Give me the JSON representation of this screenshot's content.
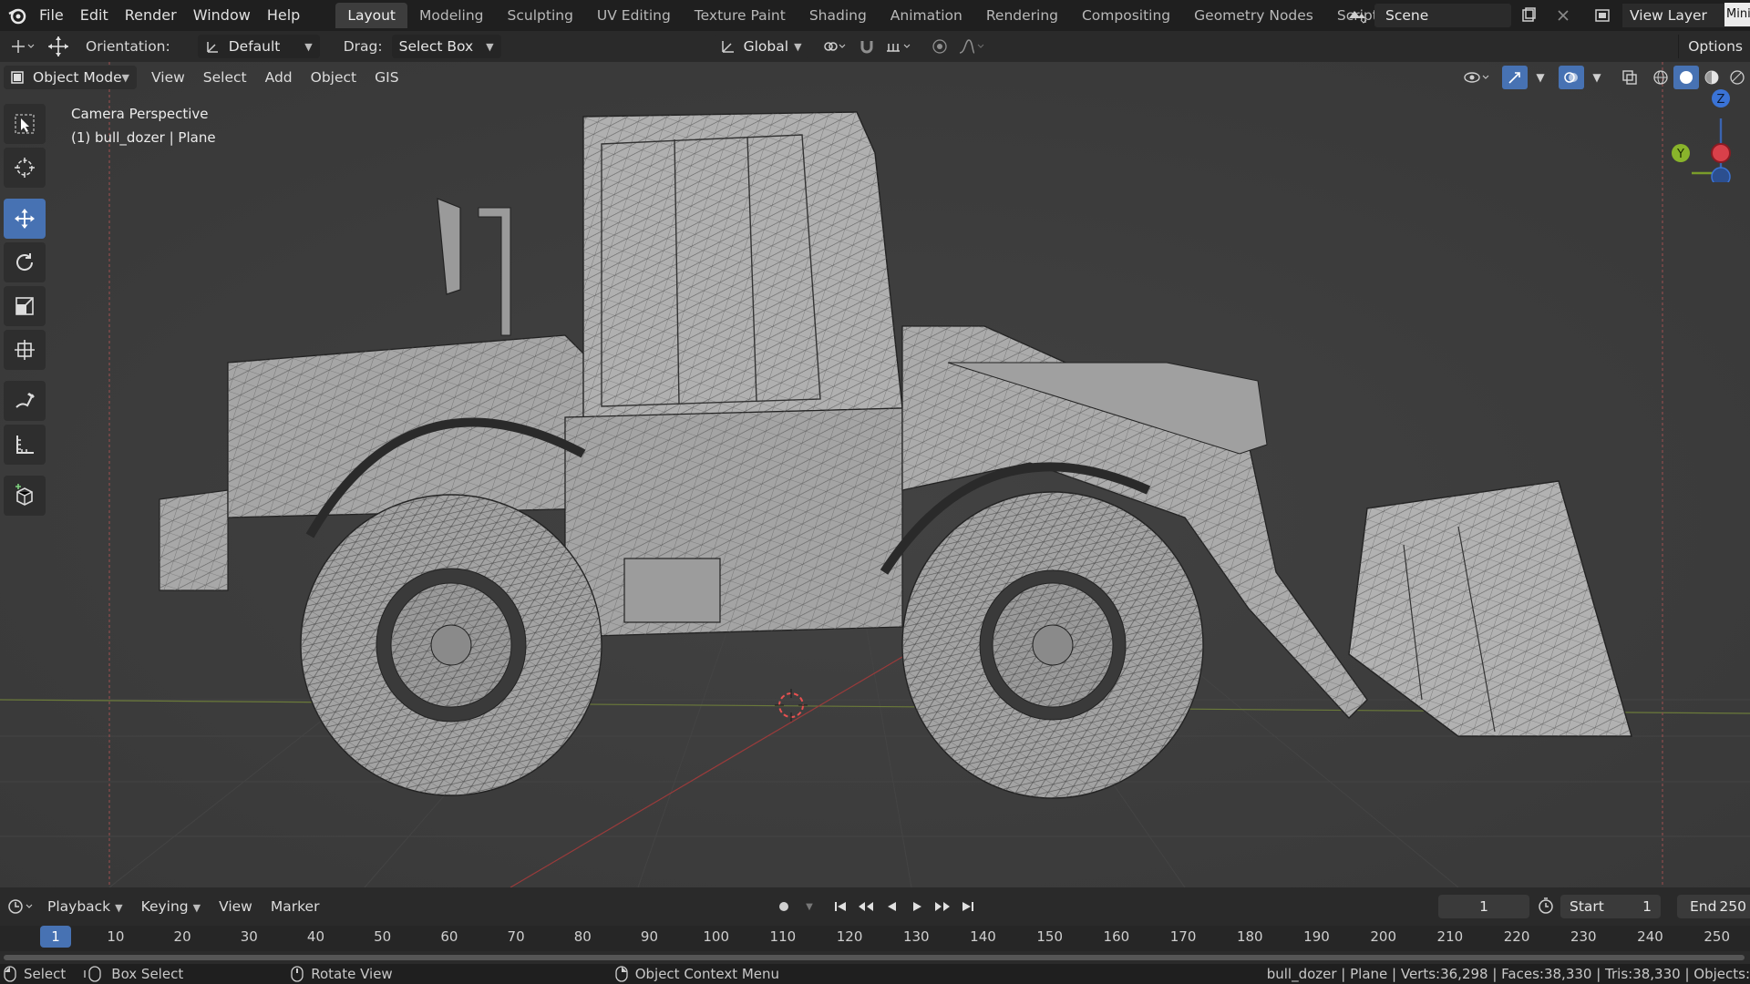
{
  "topbar": {
    "menus": [
      "File",
      "Edit",
      "Render",
      "Window",
      "Help"
    ],
    "workspaces": [
      "Layout",
      "Modeling",
      "Sculpting",
      "UV Editing",
      "Texture Paint",
      "Shading",
      "Animation",
      "Rendering",
      "Compositing",
      "Geometry Nodes",
      "Scripting"
    ],
    "active_workspace": "Layout",
    "add_tab": "+",
    "scene": "Scene",
    "view_layer": "View Layer",
    "mini_tag": "Mini"
  },
  "toolheader": {
    "orientation_label": "Orientation:",
    "orientation_value": "Default",
    "drag_label": "Drag:",
    "drag_value": "Select Box",
    "transform_orientation": "Global",
    "options": "Options"
  },
  "viewport": {
    "mode": "Object Mode",
    "menus": [
      "View",
      "Select",
      "Add",
      "Object",
      "GIS"
    ],
    "overlay_line1": "Camera Perspective",
    "overlay_line2": "(1) bull_dozer | Plane",
    "gizmo": {
      "z": "Z",
      "y": "Y"
    },
    "accent": "#4772b3"
  },
  "timeline": {
    "menus": [
      "Playback",
      "Keying",
      "View",
      "Marker"
    ],
    "current_frame": "1",
    "start_label": "Start",
    "start_value": "1",
    "end_label": "End",
    "end_value": "250",
    "ruler_labels": [
      "1",
      "10",
      "20",
      "30",
      "40",
      "50",
      "60",
      "70",
      "80",
      "90",
      "100",
      "110",
      "120",
      "130",
      "140",
      "150",
      "160",
      "170",
      "180",
      "190",
      "200",
      "210",
      "220",
      "230",
      "240",
      "250"
    ]
  },
  "statusbar": {
    "select": "Select",
    "box_select": "Box Select",
    "rotate_view": "Rotate View",
    "context_menu": "Object Context Menu",
    "stats": "bull_dozer | Plane | Verts:36,298 | Faces:38,330 | Tris:38,330 | Objects:"
  }
}
